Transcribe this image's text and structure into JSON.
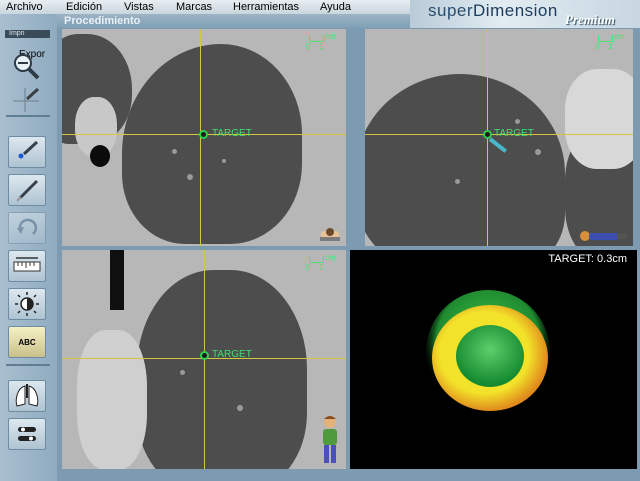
{
  "menubar": {
    "items": [
      "Archivo",
      "Edición",
      "Vistas",
      "Marcas",
      "Herramientas",
      "Ayuda"
    ]
  },
  "brand": {
    "name_prefix": "super",
    "name_suffix": "Dimension",
    "edition": "Premium"
  },
  "title": "Procedimiento",
  "toolbar": {
    "top_label": "Impn",
    "export_label": "Expor",
    "measure_text": "ABC"
  },
  "views": {
    "axial": {
      "target_label": "TARGET"
    },
    "coronal": {
      "target_label": "TARGET"
    },
    "sagittal": {
      "target_label": "TARGET"
    },
    "scale": {
      "zero": "0",
      "one": "1",
      "unit": "cm"
    }
  },
  "guidance": {
    "label": "TARGET:",
    "distance": "0.3cm"
  },
  "colors": {
    "crosshair": "#d5c640",
    "target_marker": "#2ed14e",
    "target_ring": "#f2e22a",
    "target_core": "#2eb24a"
  }
}
